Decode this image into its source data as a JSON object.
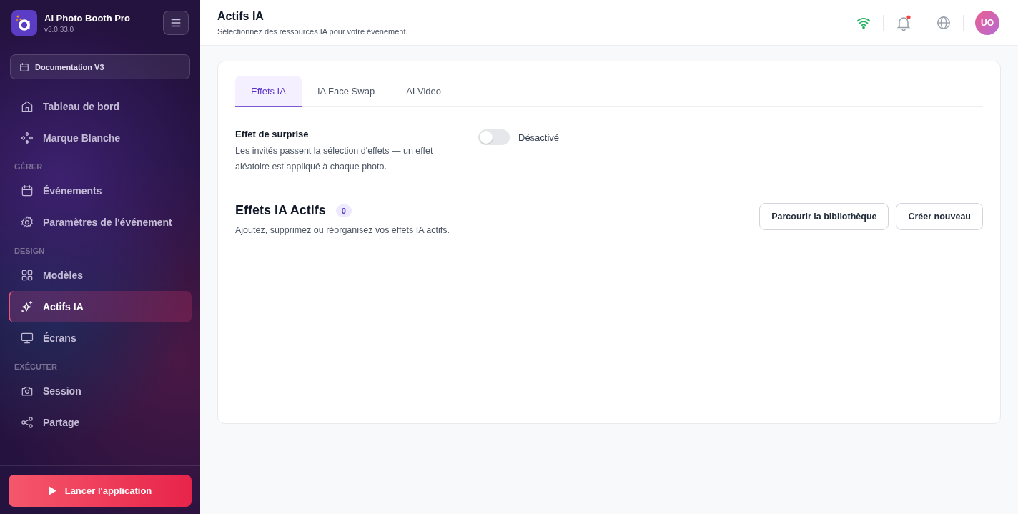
{
  "app": {
    "name": "AI Photo Booth Pro",
    "version": "v3.0.33.0"
  },
  "project": {
    "label": "Documentation V3"
  },
  "sidebar": {
    "groups": [
      {
        "items": [
          {
            "label": "Tableau de bord",
            "selected": false
          },
          {
            "label": "Marque Blanche",
            "selected": false
          }
        ]
      },
      {
        "heading": "GÉRER",
        "items": [
          {
            "label": "Événements",
            "selected": false
          },
          {
            "label": "Paramètres de l'événement",
            "selected": false
          }
        ]
      },
      {
        "heading": "DESIGN",
        "items": [
          {
            "label": "Modèles",
            "selected": false
          },
          {
            "label": "Actifs IA",
            "selected": true
          },
          {
            "label": "Écrans",
            "selected": false
          }
        ]
      },
      {
        "heading": "EXÉCUTER",
        "items": [
          {
            "label": "Session",
            "selected": false
          },
          {
            "label": "Partage",
            "selected": false
          }
        ]
      }
    ]
  },
  "launch_button": {
    "label": "Lancer l'application"
  },
  "header": {
    "title": "Actifs IA",
    "subtitle": "Sélectionnez des ressources IA pour votre événement.",
    "notification_unread": true,
    "avatar": "UO"
  },
  "tabs": [
    {
      "label": "Effets IA",
      "selected": true
    },
    {
      "label": "IA Face Swap",
      "selected": false
    },
    {
      "label": "AI Video",
      "selected": false
    }
  ],
  "surprise": {
    "title": "Effet de surprise",
    "description": "Les invités passent la sélection d'effets — un effet aléatoire est appliqué à chaque photo.",
    "on": false,
    "state_label": "Désactivé"
  },
  "active_effects": {
    "title": "Effets IA Actifs",
    "count": "0",
    "description": "Ajoutez, supprimez ou réorganisez vos effets IA actifs.",
    "buttons": [
      "Parcourir la bibliothèque",
      "Créer nouveau"
    ]
  }
}
